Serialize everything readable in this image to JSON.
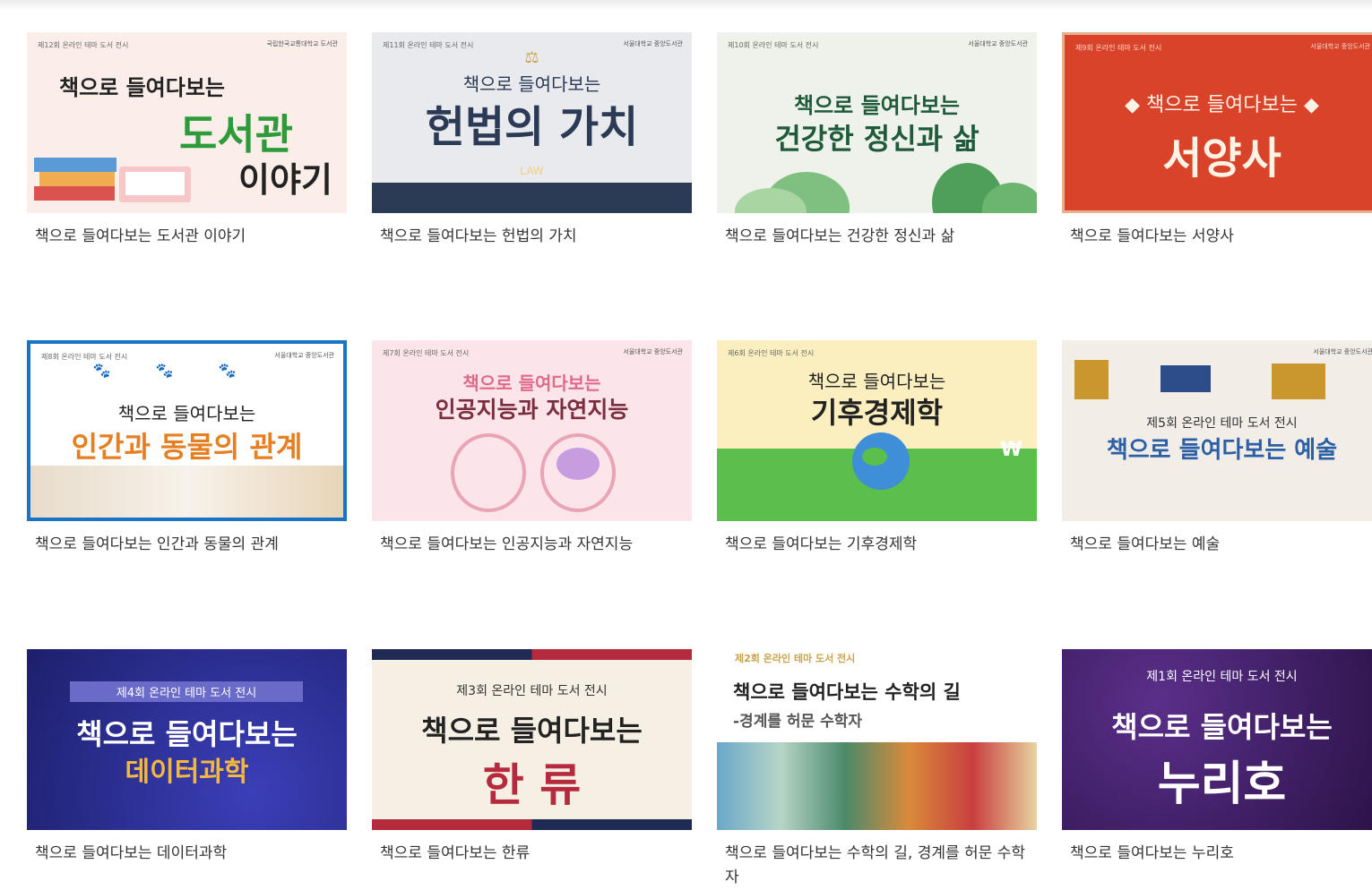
{
  "exhibitions": [
    {
      "caption": "책으로 들여다보는 도서관 이야기",
      "thumb": {
        "tag": "제12회 온라인 테마 도서 전시",
        "logo": "국립한국교통대학교 도서관",
        "prefix": "책으로 들여다보는",
        "title": "도서관",
        "title2": "이야기"
      }
    },
    {
      "caption": "책으로 들여다보는 헌법의 가치",
      "thumb": {
        "tag": "제11회 온라인 테마 도서 전시",
        "logo": "서울대학교 중앙도서관",
        "prefix": "책으로 들여다보는",
        "title": "헌법의 가치",
        "deco": "LAW"
      }
    },
    {
      "caption": "책으로 들여다보는 건강한 정신과 삶",
      "thumb": {
        "tag": "제10회 온라인 테마 도서 전시",
        "logo": "서울대학교 중앙도서관",
        "prefix": "책으로 들여다보는",
        "title": "건강한 정신과 삶"
      }
    },
    {
      "caption": "책으로 들여다보는 서양사",
      "thumb": {
        "tag": "제9회 온라인 테마 도서 전시",
        "logo": "서울대학교 중앙도서관",
        "prefix": "◆ 책으로 들여다보는 ◆",
        "title": "서양사"
      }
    },
    {
      "caption": "책으로 들여다보는 인간과 동물의 관계",
      "thumb": {
        "tag": "제8회 온라인 테마 도서 전시",
        "logo": "서울대학교 중앙도서관",
        "prefix": "책으로 들여다보는",
        "title": "인간과 동물의 관계"
      }
    },
    {
      "caption": "책으로 들여다보는 인공지능과 자연지능",
      "thumb": {
        "tag": "제7회 온라인 테마 도서 전시",
        "logo": "서울대학교 중앙도서관",
        "prefix": "책으로 들여다보는",
        "title": "인공지능과 자연지능"
      }
    },
    {
      "caption": "책으로 들여다보는 기후경제학",
      "thumb": {
        "tag": "제6회 온라인 테마 도서 전시",
        "prefix": "책으로 들여다보는",
        "title": "기후경제학",
        "deco": "₩"
      }
    },
    {
      "caption": "책으로 들여다보는 예술",
      "thumb": {
        "logo": "서울대학교 중앙도서관",
        "prefix": "제5회 온라인 테마 도서 전시",
        "title": "책으로 들여다보는 예술"
      }
    },
    {
      "caption": "책으로 들여다보는 데이터과학",
      "thumb": {
        "prefix": "제4회 온라인 테마 도서 전시",
        "title": "책으로 들여다보는",
        "title2": "데이터과학"
      }
    },
    {
      "caption": "책으로 들여다보는 한류",
      "thumb": {
        "prefix": "제3회 온라인 테마 도서 전시",
        "title": "책으로 들여다보는",
        "title2": "한 류"
      }
    },
    {
      "caption": "책으로 들여다보는 수학의 길, 경계를 허문 수학자",
      "thumb": {
        "tag": "제2회 온라인 테마 도서 전시",
        "title": "책으로 들여다보는 수학의 길",
        "title2": "-경계를 허문 수학자"
      }
    },
    {
      "caption": "책으로 들여다보는 누리호",
      "thumb": {
        "prefix": "제1회 온라인 테마 도서 전시",
        "title": "책으로 들여다보는",
        "title2": "누리호"
      }
    }
  ]
}
